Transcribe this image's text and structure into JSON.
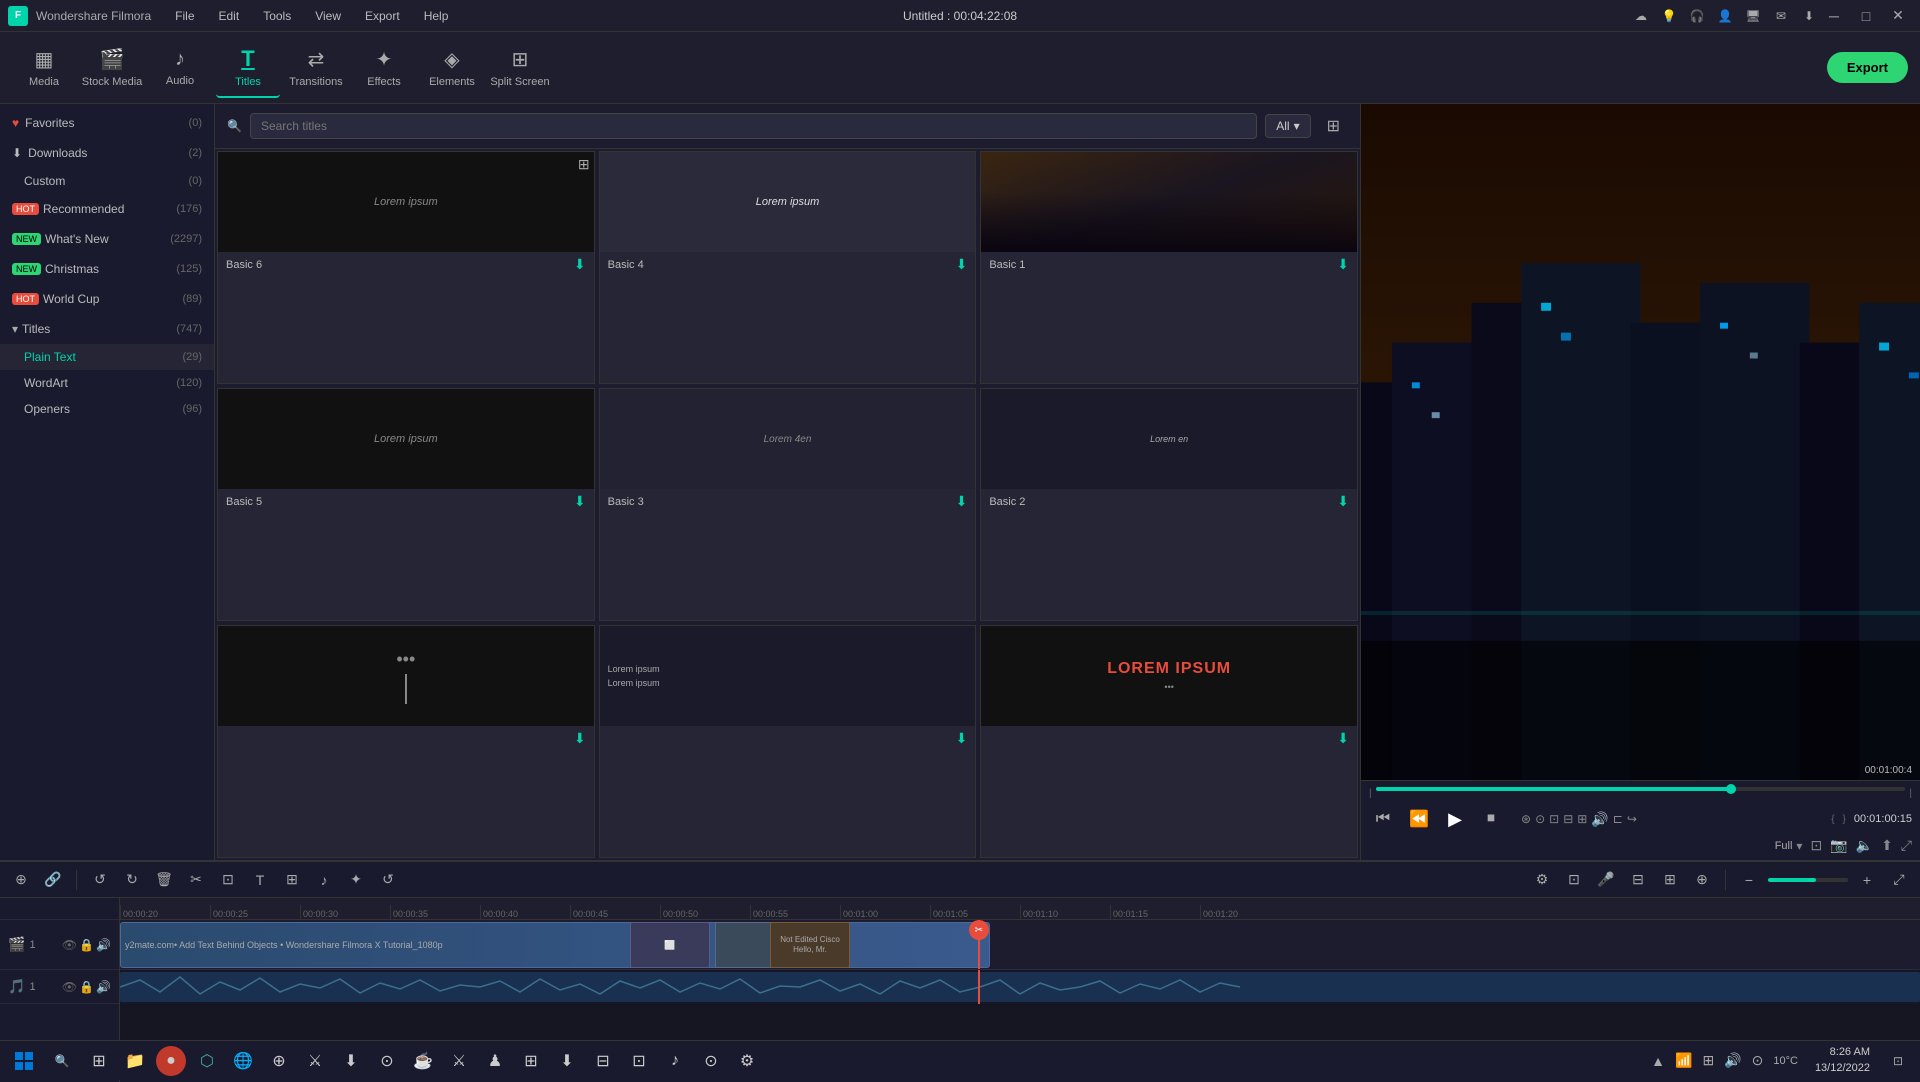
{
  "app": {
    "name": "Wondershare Filmora",
    "title": "Untitled : 00:04:22:08"
  },
  "menu": {
    "items": [
      "File",
      "Edit",
      "Tools",
      "View",
      "Export",
      "Help"
    ]
  },
  "toolbar": {
    "tools": [
      {
        "id": "media",
        "label": "Media",
        "icon": "▦"
      },
      {
        "id": "stock",
        "label": "Stock Media",
        "icon": "🎬"
      },
      {
        "id": "audio",
        "label": "Audio",
        "icon": "♪"
      },
      {
        "id": "titles",
        "label": "Titles",
        "icon": "T",
        "active": true
      },
      {
        "id": "transitions",
        "label": "Transitions",
        "icon": "⇄"
      },
      {
        "id": "effects",
        "label": "Effects",
        "icon": "✦"
      },
      {
        "id": "elements",
        "label": "Elements",
        "icon": "◈"
      },
      {
        "id": "split",
        "label": "Split Screen",
        "icon": "⊞"
      }
    ],
    "export_label": "Export"
  },
  "sidebar": {
    "items": [
      {
        "id": "favorites",
        "label": "Favorites",
        "count": "(0)",
        "icon": "♥"
      },
      {
        "id": "downloads",
        "label": "Downloads",
        "count": "(2)"
      },
      {
        "id": "custom",
        "label": "Custom",
        "count": "(0)",
        "indent": true
      },
      {
        "id": "recommended",
        "label": "Recommended",
        "count": "(176)",
        "badge": "HOT"
      },
      {
        "id": "whatsnew",
        "label": "What's New",
        "count": "(2297)",
        "badge": "NEW"
      },
      {
        "id": "christmas",
        "label": "Christmas",
        "count": "(125)",
        "badge": "NEW"
      },
      {
        "id": "worldcup",
        "label": "World Cup",
        "count": "(89)",
        "badge": "HOT"
      },
      {
        "id": "titles",
        "label": "Titles",
        "count": "(747)",
        "expandable": true
      },
      {
        "id": "plaintext",
        "label": "Plain Text",
        "count": "(29)",
        "indent": true,
        "active": true
      },
      {
        "id": "wordart",
        "label": "WordArt",
        "count": "(120)",
        "indent": true
      },
      {
        "id": "openers",
        "label": "Openers",
        "count": "(96)",
        "indent": true
      }
    ]
  },
  "search": {
    "placeholder": "Search titles",
    "filter_label": "All"
  },
  "titles_grid": {
    "cards": [
      {
        "id": "basic6",
        "name": "Basic 6",
        "style": "dark",
        "text": "Lorem ipsum"
      },
      {
        "id": "basic4",
        "name": "Basic 4",
        "style": "gray",
        "text": "Lorem ipsum"
      },
      {
        "id": "basic1",
        "name": "Basic 1",
        "style": "photo",
        "text": ""
      },
      {
        "id": "basic5",
        "name": "Basic 5",
        "style": "dark",
        "text": "Lorem ipsum"
      },
      {
        "id": "basic3",
        "name": "Basic 3",
        "style": "gray2",
        "text": "Lorem 4en"
      },
      {
        "id": "basic2",
        "name": "Basic 2",
        "style": "dark2",
        "text": "Lorem en"
      },
      {
        "id": "card7",
        "name": "",
        "style": "dark3",
        "text": "I"
      },
      {
        "id": "card8",
        "name": "",
        "style": "dark4",
        "text": "Lorem ipsum"
      },
      {
        "id": "card9",
        "name": "",
        "style": "red",
        "text": "LOREM IPSUM"
      }
    ]
  },
  "preview": {
    "time": "00:01:00:15",
    "duration": "Full",
    "progress_pct": 68
  },
  "timeline": {
    "current_time": "00:01:00:15",
    "playhead_pct": 53,
    "ticks": [
      "00:20",
      "00:25",
      "00:30",
      "00:35",
      "00:40",
      "00:45",
      "00:50",
      "00:55",
      "01:00",
      "01:05",
      "01:10",
      "01:15",
      "01:20"
    ],
    "video_track": "🎬 1",
    "audio_track": "🎵 1"
  },
  "taskbar": {
    "time": "8:26 AM",
    "date": "13/12/2022",
    "temp": "10°C"
  },
  "win_controls": {
    "minimize": "─",
    "maximize": "□",
    "close": "✕"
  }
}
